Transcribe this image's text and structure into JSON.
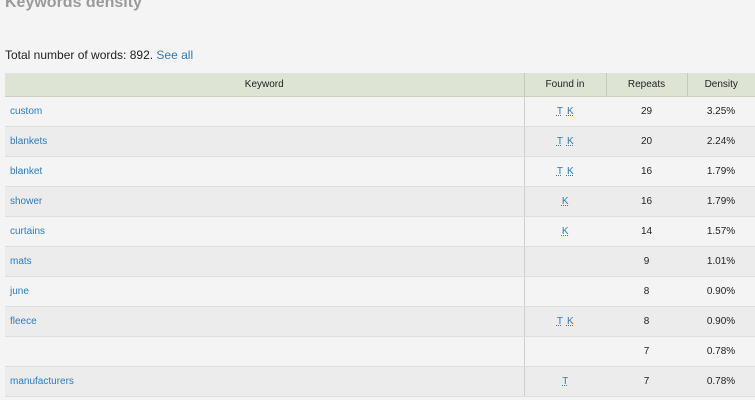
{
  "page": {
    "title": "Keywords density",
    "summary_text": "Total number of words: 892.",
    "see_all_label": "See all"
  },
  "table": {
    "columns": {
      "keyword": "Keyword",
      "found_in": "Found in",
      "repeats": "Repeats",
      "density": "Density"
    },
    "rows": [
      {
        "keyword": "custom",
        "found_in": [
          "T",
          "K"
        ],
        "repeats": "29",
        "density": "3.25%"
      },
      {
        "keyword": "blankets",
        "found_in": [
          "T",
          "K"
        ],
        "repeats": "20",
        "density": "2.24%"
      },
      {
        "keyword": "blanket",
        "found_in": [
          "T",
          "K"
        ],
        "repeats": "16",
        "density": "1.79%"
      },
      {
        "keyword": "shower",
        "found_in": [
          "K"
        ],
        "repeats": "16",
        "density": "1.79%"
      },
      {
        "keyword": "curtains",
        "found_in": [
          "K"
        ],
        "repeats": "14",
        "density": "1.57%"
      },
      {
        "keyword": "mats",
        "found_in": [],
        "repeats": "9",
        "density": "1.01%"
      },
      {
        "keyword": "june",
        "found_in": [],
        "repeats": "8",
        "density": "0.90%"
      },
      {
        "keyword": "fleece",
        "found_in": [
          "T",
          "K"
        ],
        "repeats": "8",
        "density": "0.90%"
      },
      {
        "keyword": "",
        "found_in": [],
        "repeats": "7",
        "density": "0.78%"
      },
      {
        "keyword": "manufacturers",
        "found_in": [
          "T"
        ],
        "repeats": "7",
        "density": "0.78%"
      }
    ]
  }
}
